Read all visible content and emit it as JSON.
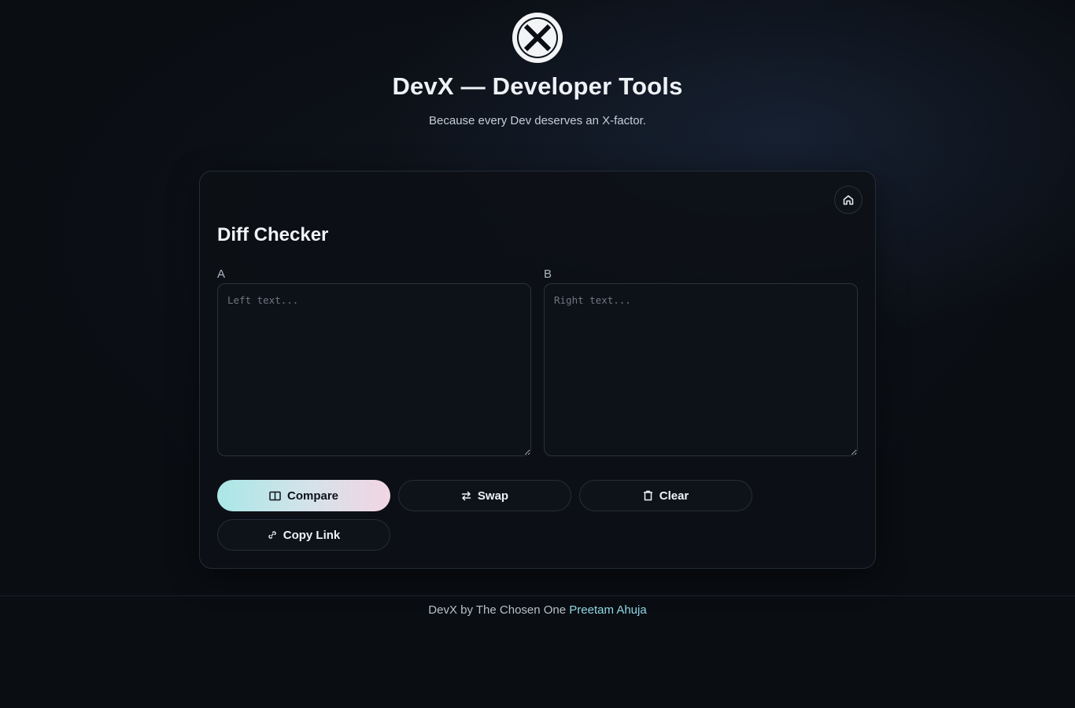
{
  "header": {
    "logo_icon": "x-circle-logo",
    "title": "DevX — Developer Tools",
    "tagline": "Because every Dev deserves an X-factor."
  },
  "tool": {
    "title": "Diff Checker",
    "home_icon": "home-icon",
    "pane_a": {
      "label": "A",
      "placeholder": "Left text...",
      "value": ""
    },
    "pane_b": {
      "label": "B",
      "placeholder": "Right text...",
      "value": ""
    }
  },
  "actions": {
    "compare": {
      "label": "Compare",
      "icon": "columns-icon"
    },
    "swap": {
      "label": "Swap",
      "icon": "swap-arrows-icon"
    },
    "clear": {
      "label": "Clear",
      "icon": "trash-icon"
    },
    "copy_link": {
      "label": "Copy Link",
      "icon": "link-icon"
    }
  },
  "footer": {
    "prefix": "DevX by The Chosen One",
    "author": "Preetam Ahuja"
  },
  "colors": {
    "background": "#0a0d12",
    "accent_start": "#a9e7e6",
    "accent_end": "#f2d5e3",
    "link": "#8fd8e6"
  }
}
